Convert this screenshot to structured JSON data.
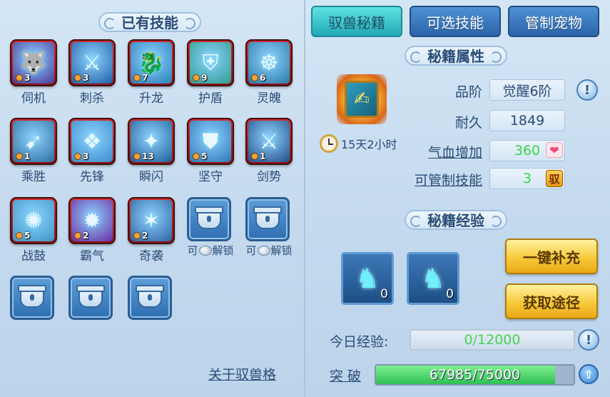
{
  "left": {
    "title": "已有技能",
    "skills": [
      {
        "label": "伺机",
        "level": "3",
        "icon": "wolf-icon",
        "bg": "#4a3a9a"
      },
      {
        "label": "刺杀",
        "level": "3",
        "icon": "assassin-icon",
        "bg": "#1f5fa6"
      },
      {
        "label": "升龙",
        "level": "7",
        "icon": "dragon-icon",
        "bg": "#2a7fb8"
      },
      {
        "label": "护盾",
        "level": "9",
        "icon": "shield-icon",
        "bg": "#2b9c8f"
      },
      {
        "label": "灵魄",
        "level": "6",
        "icon": "spirit-icon",
        "bg": "#2a7aa8"
      },
      {
        "label": "乘胜",
        "level": "1",
        "icon": "charge-icon",
        "bg": "#2d6fa0"
      },
      {
        "label": "先锋",
        "level": "3",
        "icon": "crystal-icon",
        "bg": "#3a8ccb"
      },
      {
        "label": "瞬闪",
        "level": "13",
        "icon": "beast-icon",
        "bg": "#1f5f98"
      },
      {
        "label": "坚守",
        "level": "5",
        "icon": "guard-icon",
        "bg": "#2f78b8"
      },
      {
        "label": "剑势",
        "level": "1",
        "icon": "sword-icon",
        "bg": "#234e8a"
      },
      {
        "label": "战鼓",
        "level": "5",
        "icon": "drum-icon",
        "bg": "#3c97c7"
      },
      {
        "label": "霸气",
        "level": "2",
        "icon": "aura-icon",
        "bg": "#6a2ea3"
      },
      {
        "label": "奇袭",
        "level": "2",
        "icon": "raid-icon",
        "bg": "#2e63a2"
      }
    ],
    "unlock_prefix": "可",
    "unlock_suffix": "解锁",
    "about_link": "关于驭兽格"
  },
  "tabs": {
    "tab1": "驭兽秘籍",
    "tab2": "可选技能",
    "tab3": "管制宠物"
  },
  "attributes": {
    "title": "秘籍属性",
    "timer": "15天2小时",
    "quality_label": "品阶",
    "quality_value": "觉醒6阶",
    "durability_label": "耐久",
    "durability_value": "1849",
    "hp_label": "气血增加",
    "hp_value": "360",
    "control_label": "可管制技能",
    "control_value": "3",
    "control_icon_text": "驭"
  },
  "experience": {
    "title": "秘籍经验",
    "item1_count": "0",
    "item2_count": "0",
    "refill_button": "一键补充",
    "obtain_button": "获取途径",
    "today_label": "今日经验:",
    "today_value": "0/12000",
    "today_fraction": 0,
    "breakthrough_label": "突 破",
    "breakthrough_value": "67985/75000",
    "breakthrough_fraction": 0.9065
  },
  "colors": {
    "accent_tab": "#22a9b6",
    "green_text": "#35d64a",
    "gold_button": "#f7c93a"
  }
}
